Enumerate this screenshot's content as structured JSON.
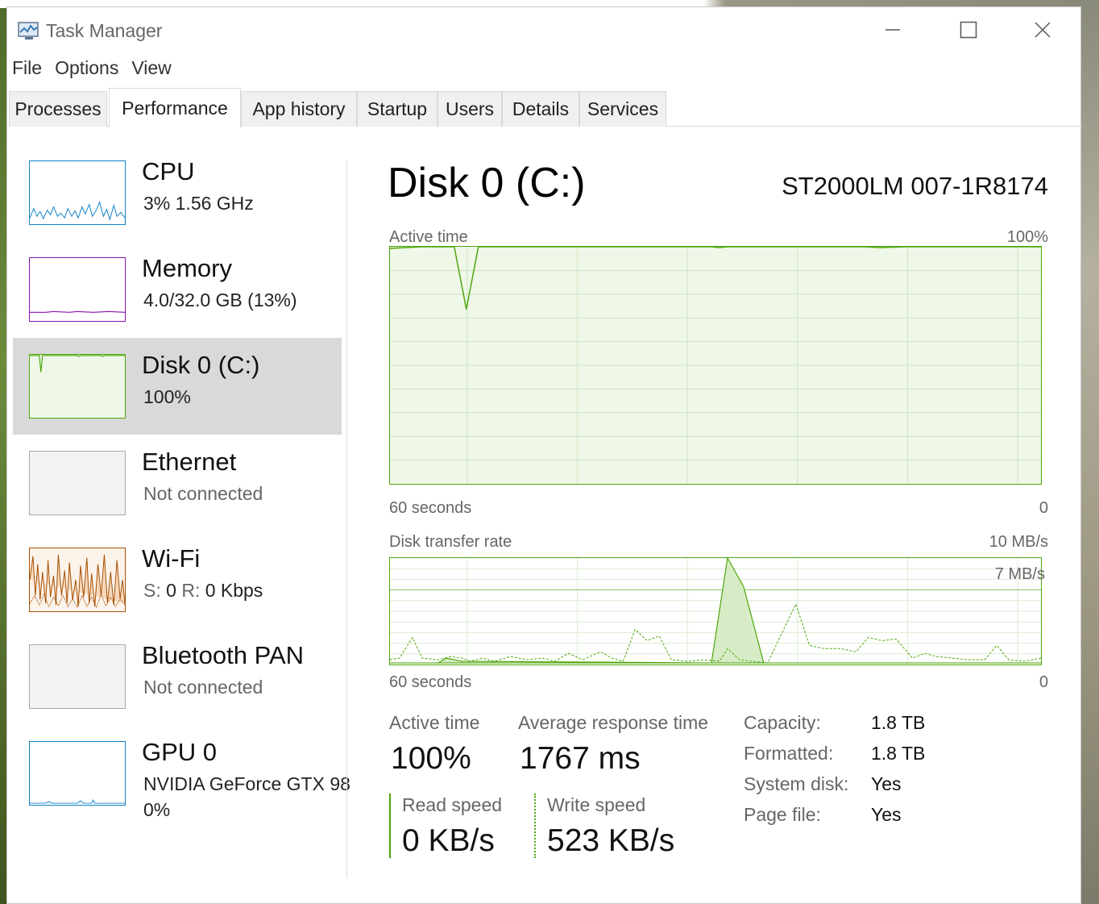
{
  "window": {
    "title": "Task Manager",
    "controls": {
      "minimize": "—",
      "maximize": "☐",
      "close": "✕"
    }
  },
  "menu": [
    "File",
    "Options",
    "View"
  ],
  "tabs": [
    {
      "label": "Processes",
      "active": false
    },
    {
      "label": "Performance",
      "active": true
    },
    {
      "label": "App history",
      "active": false
    },
    {
      "label": "Startup",
      "active": false
    },
    {
      "label": "Users",
      "active": false
    },
    {
      "label": "Details",
      "active": false
    },
    {
      "label": "Services",
      "active": false
    }
  ],
  "sidebar": [
    {
      "name": "CPU",
      "sub": "3%  1.56 GHz",
      "color": "#1183c7",
      "fill": "#ffffff"
    },
    {
      "name": "Memory",
      "sub": "4.0/32.0 GB (13%)",
      "color": "#8b12ae",
      "fill": "#ffffff"
    },
    {
      "name": "Disk 0 (C:)",
      "sub": "100%",
      "color": "#4da60c",
      "fill": "#eff7e8",
      "selected": true
    },
    {
      "name": "Ethernet",
      "sub": "Not connected",
      "color": "#aaaaaa",
      "fill": "#f2f2f2"
    },
    {
      "name": "Wi-Fi",
      "sub_parts": {
        "s_label": "S:",
        "s_value": "0",
        "r_label": "R:",
        "r_value": "0 Kbps"
      },
      "color": "#a74f01",
      "fill": "#fcf3eb"
    },
    {
      "name": "Bluetooth PAN",
      "sub": "Not connected",
      "color": "#aaaaaa",
      "fill": "#f2f2f2"
    },
    {
      "name": "GPU 0",
      "sub": "NVIDIA GeForce GTX 98",
      "sub2": "0%",
      "color": "#1183c7",
      "fill": "#ffffff"
    }
  ],
  "disk": {
    "title": "Disk 0 (C:)",
    "model": "ST2000LM 007-1R8174",
    "active_chart": {
      "label": "Active time",
      "max": "100%",
      "time": "60 seconds",
      "zero": "0"
    },
    "transfer_chart": {
      "label": "Disk transfer rate",
      "max": "10 MB/s",
      "line_label": "7 MB/s",
      "time": "60 seconds",
      "zero": "0"
    },
    "stats": {
      "active_time_label": "Active time",
      "active_time_value": "100%",
      "avg_response_label": "Average response time",
      "avg_response_value": "1767 ms",
      "read_label": "Read speed",
      "read_value": "0 KB/s",
      "write_label": "Write speed",
      "write_value": "523 KB/s"
    },
    "properties": [
      {
        "label": "Capacity:",
        "value": "1.8 TB"
      },
      {
        "label": "Formatted:",
        "value": "1.8 TB"
      },
      {
        "label": "System disk:",
        "value": "Yes"
      },
      {
        "label": "Page file:",
        "value": "Yes"
      }
    ]
  },
  "colors": {
    "disk_green": "#4da60c",
    "disk_fill": "#eff7e8",
    "selected_bg": "#d9d9d9"
  }
}
